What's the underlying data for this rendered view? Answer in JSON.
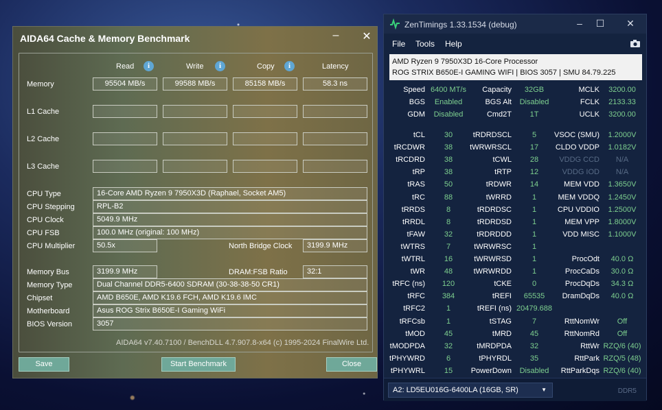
{
  "aida": {
    "title": "AIDA64 Cache & Memory Benchmark",
    "col_read": "Read",
    "col_write": "Write",
    "col_copy": "Copy",
    "col_latency": "Latency",
    "rows": {
      "memory": "Memory",
      "l1": "L1 Cache",
      "l2": "L2 Cache",
      "l3": "L3 Cache"
    },
    "memory_read": "95504 MB/s",
    "memory_write": "99588 MB/s",
    "memory_copy": "85158 MB/s",
    "memory_latency": "58.3 ns",
    "cpu_type_label": "CPU Type",
    "cpu_type": "16-Core AMD Ryzen 9 7950X3D  (Raphael, Socket AM5)",
    "cpu_stepping_label": "CPU Stepping",
    "cpu_stepping": "RPL-B2",
    "cpu_clock_label": "CPU Clock",
    "cpu_clock": "5049.9 MHz",
    "cpu_fsb_label": "CPU FSB",
    "cpu_fsb": "100.0 MHz  (original: 100 MHz)",
    "cpu_mult_label": "CPU Multiplier",
    "cpu_mult": "50.5x",
    "nb_clock_label": "North Bridge Clock",
    "nb_clock": "3199.9 MHz",
    "mem_bus_label": "Memory Bus",
    "mem_bus": "3199.9 MHz",
    "dram_fsb_label": "DRAM:FSB Ratio",
    "dram_fsb": "32:1",
    "mem_type_label": "Memory Type",
    "mem_type": "Dual Channel DDR5-6400 SDRAM  (30-38-38-50 CR1)",
    "chipset_label": "Chipset",
    "chipset": "AMD B650E, AMD K19.6 FCH, AMD K19.6 IMC",
    "motherboard_label": "Motherboard",
    "motherboard": "Asus ROG Strix B650E-I Gaming WiFi",
    "bios_label": "BIOS Version",
    "bios": "3057",
    "copyright": "AIDA64 v7.40.7100 / BenchDLL 4.7.907.8-x64  (c) 1995-2024 FinalWire Ltd.",
    "save": "Save",
    "start": "Start Benchmark",
    "close": "Close"
  },
  "zen": {
    "title": "ZenTimings 1.33.1534 (debug)",
    "menu_file": "File",
    "menu_tools": "Tools",
    "menu_help": "Help",
    "cpu": "AMD Ryzen 9 7950X3D 16-Core Processor",
    "board": "ROG STRIX B650E-I GAMING WIFI | BIOS 3057 | SMU 84.79.225",
    "top": [
      [
        "Speed",
        "6400 MT/s",
        "Capacity",
        "32GB",
        "MCLK",
        "3200.00"
      ],
      [
        "BGS",
        "Enabled",
        "BGS Alt",
        "Disabled",
        "FCLK",
        "2133.33"
      ],
      [
        "GDM",
        "Disabled",
        "Cmd2T",
        "1T",
        "UCLK",
        "3200.00"
      ]
    ],
    "timings": [
      [
        "tCL",
        "30",
        "tRDRDSCL",
        "5",
        "VSOC (SMU)",
        "1.2000V"
      ],
      [
        "tRCDWR",
        "38",
        "tWRWRSCL",
        "17",
        "CLDO VDDP",
        "1.0182V"
      ],
      [
        "tRCDRD",
        "38",
        "tCWL",
        "28",
        "VDDG CCD",
        "N/A"
      ],
      [
        "tRP",
        "38",
        "tRTP",
        "12",
        "VDDG IOD",
        "N/A"
      ],
      [
        "tRAS",
        "50",
        "tRDWR",
        "14",
        "MEM VDD",
        "1.3650V"
      ],
      [
        "tRC",
        "88",
        "tWRRD",
        "1",
        "MEM VDDQ",
        "1.2450V"
      ],
      [
        "tRRDS",
        "8",
        "tRDRDSC",
        "1",
        "CPU VDDIO",
        "1.2500V"
      ],
      [
        "tRRDL",
        "8",
        "tRDRDSD",
        "1",
        "MEM VPP",
        "1.8000V"
      ],
      [
        "tFAW",
        "32",
        "tRDRDDD",
        "1",
        "VDD MISC",
        "1.1000V"
      ],
      [
        "tWTRS",
        "7",
        "tWRWRSC",
        "1",
        "",
        ""
      ],
      [
        "tWTRL",
        "16",
        "tWRWRSD",
        "1",
        "ProcOdt",
        "40.0 Ω"
      ],
      [
        "tWR",
        "48",
        "tWRWRDD",
        "1",
        "ProcCaDs",
        "30.0 Ω"
      ],
      [
        "tRFC (ns)",
        "120",
        "tCKE",
        "0",
        "ProcDqDs",
        "34.3 Ω"
      ],
      [
        "tRFC",
        "384",
        "tREFI",
        "65535",
        "DramDqDs",
        "40.0 Ω"
      ],
      [
        "tRFC2",
        "1",
        "tREFI (ns)",
        "20479.688",
        "",
        ""
      ],
      [
        "tRFCsb",
        "1",
        "tSTAG",
        "7",
        "RttNomWr",
        "Off"
      ],
      [
        "tMOD",
        "45",
        "tMRD",
        "45",
        "RttNomRd",
        "Off"
      ],
      [
        "tMODPDA",
        "32",
        "tMRDPDA",
        "32",
        "RttWr",
        "RZQ/6 (40)"
      ],
      [
        "tPHYWRD",
        "6",
        "tPHYRDL",
        "35",
        "RttPark",
        "RZQ/5 (48)"
      ],
      [
        "tPHYWRL",
        "15",
        "PowerDown",
        "Disabled",
        "RttParkDqs",
        "RZQ/6 (40)"
      ]
    ],
    "module": "A2: LD5EU016G-6400LA (16GB, SR)",
    "ddr": "DDR5"
  }
}
